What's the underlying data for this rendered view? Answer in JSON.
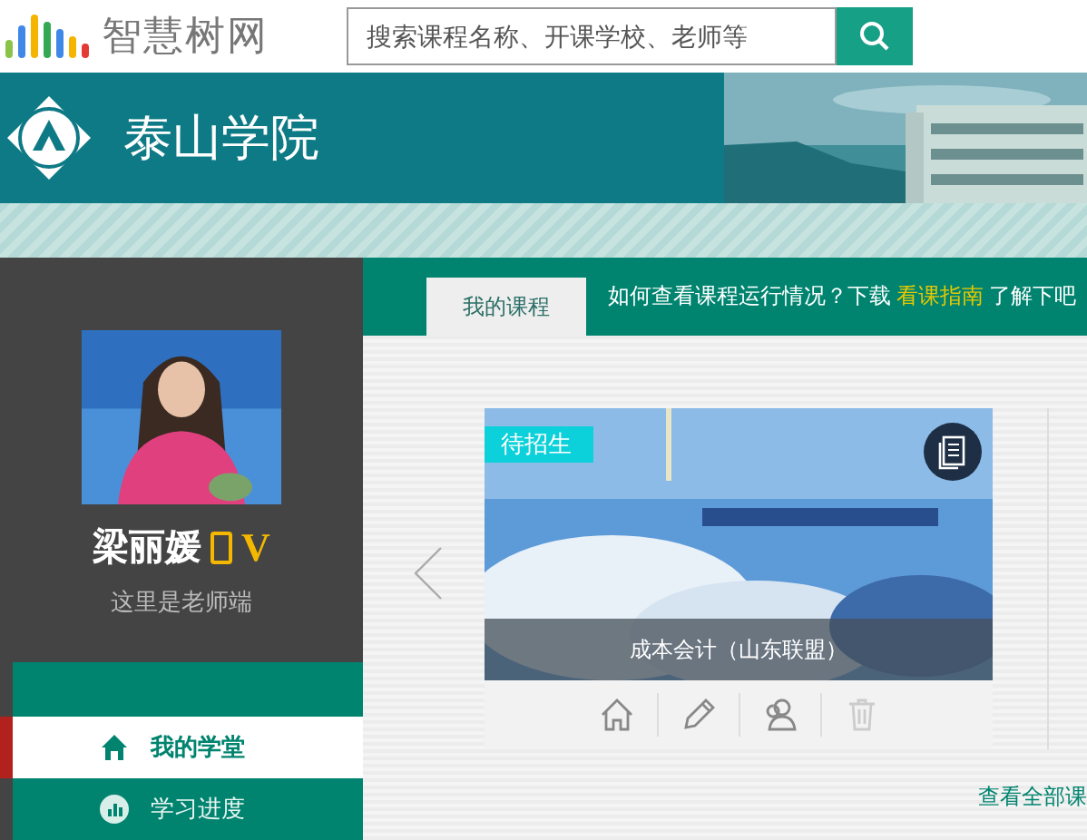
{
  "top_bar": {
    "logo_text": "智慧树网",
    "search": {
      "placeholder": "搜索课程名称、开课学校、老师等"
    }
  },
  "header": {
    "school_name": "泰山学院"
  },
  "profile": {
    "name": "梁丽媛",
    "badge": "V",
    "subtitle": "这里是老师端"
  },
  "menu": [
    {
      "label": "我的学堂",
      "kind": "home",
      "selected": true
    },
    {
      "label": "学习进度",
      "kind": "chart",
      "selected": false
    }
  ],
  "tabs": [
    {
      "label": "我的课程",
      "selected": true
    }
  ],
  "notice": {
    "before": "如何查看课程运行情况？下载",
    "link": "看课指南",
    "after": "了解下吧"
  },
  "course": {
    "status": "待招生",
    "title": "成本会计（山东联盟）",
    "actions": [
      {
        "kind": "home",
        "disabled": false
      },
      {
        "kind": "edit",
        "disabled": false
      },
      {
        "kind": "students",
        "disabled": false
      },
      {
        "kind": "delete",
        "disabled": true
      }
    ]
  },
  "view_all_link": "查看全部课"
}
